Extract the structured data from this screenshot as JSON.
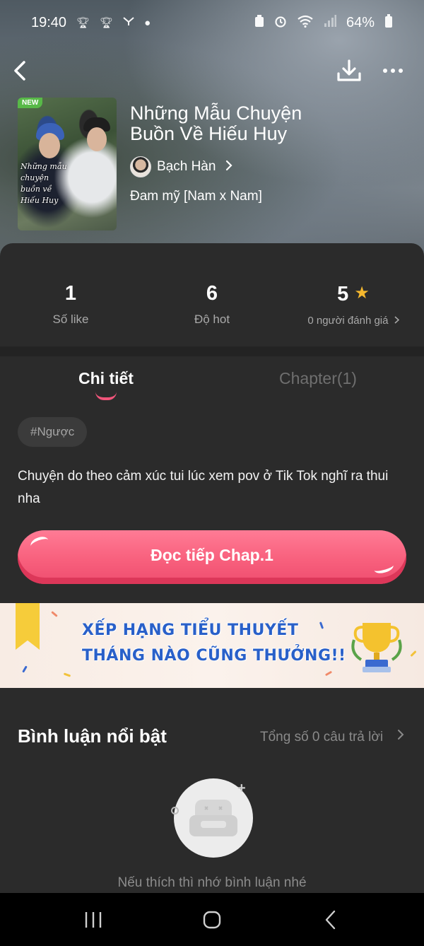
{
  "status_bar": {
    "time": "19:40",
    "battery": "64%",
    "icons": [
      "trophy-icon",
      "trophy-icon",
      "app-icon",
      "dot-icon",
      "battery-saver-icon",
      "alarm-icon",
      "wifi-icon",
      "signal-icon",
      "battery-icon"
    ]
  },
  "top_nav": {
    "back_icon": "back-arrow-icon",
    "download_icon": "download-icon",
    "more_icon": "more-dots-icon"
  },
  "story": {
    "badge": "NEW",
    "cover_text": "Những mẫu chuyện buồn về Hiếu Huy",
    "title": "Những Mẫu Chuyện Buồn Về Hiếu Huy",
    "author": "Bạch Hàn",
    "genre": "Đam mỹ [Nam x Nam]"
  },
  "stats": [
    {
      "value": "1",
      "label": "Số like"
    },
    {
      "value": "6",
      "label": "Độ hot"
    },
    {
      "value": "5",
      "label": "0 người đánh giá"
    }
  ],
  "tabs": {
    "active": "Chi tiết",
    "inactive": "Chapter(1)"
  },
  "tag": "#Ngược",
  "description": "Chuyện do theo cảm xúc tui lúc xem pov ở Tik Tok nghĩ ra thui nha",
  "read_button": "Đọc tiếp Chap.1",
  "banner": {
    "line1": "XẾP HẠNG TIỂU THUYẾT",
    "line2": "THÁNG NÀO CŨNG THƯỞNG!!"
  },
  "comments": {
    "title": "Bình luận nổi bật",
    "total": "Tổng số 0 câu trả lời",
    "empty_text": "Nếu thích thì nhớ bình luận nhé"
  },
  "colors": {
    "accent": "#f0557a",
    "button": "#f8607d",
    "star": "#f5b82e",
    "banner_text": "#2960c9",
    "background": "#2b2b2b"
  }
}
